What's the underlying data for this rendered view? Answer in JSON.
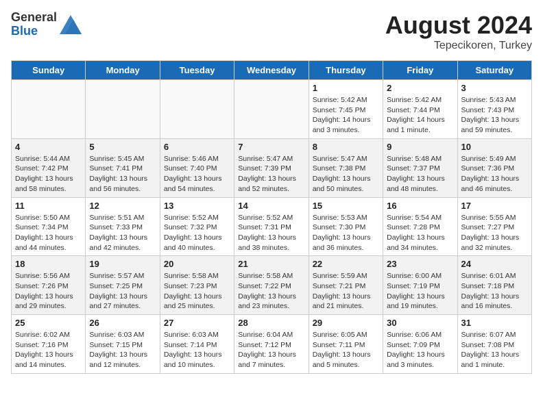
{
  "header": {
    "logo_general": "General",
    "logo_blue": "Blue",
    "month_year": "August 2024",
    "location": "Tepecikoren, Turkey"
  },
  "days_of_week": [
    "Sunday",
    "Monday",
    "Tuesday",
    "Wednesday",
    "Thursday",
    "Friday",
    "Saturday"
  ],
  "weeks": [
    [
      {
        "day": null
      },
      {
        "day": null
      },
      {
        "day": null
      },
      {
        "day": null
      },
      {
        "day": 1,
        "sunrise": "Sunrise: 5:42 AM",
        "sunset": "Sunset: 7:45 PM",
        "daylight": "Daylight: 14 hours and 3 minutes."
      },
      {
        "day": 2,
        "sunrise": "Sunrise: 5:42 AM",
        "sunset": "Sunset: 7:44 PM",
        "daylight": "Daylight: 14 hours and 1 minute."
      },
      {
        "day": 3,
        "sunrise": "Sunrise: 5:43 AM",
        "sunset": "Sunset: 7:43 PM",
        "daylight": "Daylight: 13 hours and 59 minutes."
      }
    ],
    [
      {
        "day": 4,
        "sunrise": "Sunrise: 5:44 AM",
        "sunset": "Sunset: 7:42 PM",
        "daylight": "Daylight: 13 hours and 58 minutes."
      },
      {
        "day": 5,
        "sunrise": "Sunrise: 5:45 AM",
        "sunset": "Sunset: 7:41 PM",
        "daylight": "Daylight: 13 hours and 56 minutes."
      },
      {
        "day": 6,
        "sunrise": "Sunrise: 5:46 AM",
        "sunset": "Sunset: 7:40 PM",
        "daylight": "Daylight: 13 hours and 54 minutes."
      },
      {
        "day": 7,
        "sunrise": "Sunrise: 5:47 AM",
        "sunset": "Sunset: 7:39 PM",
        "daylight": "Daylight: 13 hours and 52 minutes."
      },
      {
        "day": 8,
        "sunrise": "Sunrise: 5:47 AM",
        "sunset": "Sunset: 7:38 PM",
        "daylight": "Daylight: 13 hours and 50 minutes."
      },
      {
        "day": 9,
        "sunrise": "Sunrise: 5:48 AM",
        "sunset": "Sunset: 7:37 PM",
        "daylight": "Daylight: 13 hours and 48 minutes."
      },
      {
        "day": 10,
        "sunrise": "Sunrise: 5:49 AM",
        "sunset": "Sunset: 7:36 PM",
        "daylight": "Daylight: 13 hours and 46 minutes."
      }
    ],
    [
      {
        "day": 11,
        "sunrise": "Sunrise: 5:50 AM",
        "sunset": "Sunset: 7:34 PM",
        "daylight": "Daylight: 13 hours and 44 minutes."
      },
      {
        "day": 12,
        "sunrise": "Sunrise: 5:51 AM",
        "sunset": "Sunset: 7:33 PM",
        "daylight": "Daylight: 13 hours and 42 minutes."
      },
      {
        "day": 13,
        "sunrise": "Sunrise: 5:52 AM",
        "sunset": "Sunset: 7:32 PM",
        "daylight": "Daylight: 13 hours and 40 minutes."
      },
      {
        "day": 14,
        "sunrise": "Sunrise: 5:52 AM",
        "sunset": "Sunset: 7:31 PM",
        "daylight": "Daylight: 13 hours and 38 minutes."
      },
      {
        "day": 15,
        "sunrise": "Sunrise: 5:53 AM",
        "sunset": "Sunset: 7:30 PM",
        "daylight": "Daylight: 13 hours and 36 minutes."
      },
      {
        "day": 16,
        "sunrise": "Sunrise: 5:54 AM",
        "sunset": "Sunset: 7:28 PM",
        "daylight": "Daylight: 13 hours and 34 minutes."
      },
      {
        "day": 17,
        "sunrise": "Sunrise: 5:55 AM",
        "sunset": "Sunset: 7:27 PM",
        "daylight": "Daylight: 13 hours and 32 minutes."
      }
    ],
    [
      {
        "day": 18,
        "sunrise": "Sunrise: 5:56 AM",
        "sunset": "Sunset: 7:26 PM",
        "daylight": "Daylight: 13 hours and 29 minutes."
      },
      {
        "day": 19,
        "sunrise": "Sunrise: 5:57 AM",
        "sunset": "Sunset: 7:25 PM",
        "daylight": "Daylight: 13 hours and 27 minutes."
      },
      {
        "day": 20,
        "sunrise": "Sunrise: 5:58 AM",
        "sunset": "Sunset: 7:23 PM",
        "daylight": "Daylight: 13 hours and 25 minutes."
      },
      {
        "day": 21,
        "sunrise": "Sunrise: 5:58 AM",
        "sunset": "Sunset: 7:22 PM",
        "daylight": "Daylight: 13 hours and 23 minutes."
      },
      {
        "day": 22,
        "sunrise": "Sunrise: 5:59 AM",
        "sunset": "Sunset: 7:21 PM",
        "daylight": "Daylight: 13 hours and 21 minutes."
      },
      {
        "day": 23,
        "sunrise": "Sunrise: 6:00 AM",
        "sunset": "Sunset: 7:19 PM",
        "daylight": "Daylight: 13 hours and 19 minutes."
      },
      {
        "day": 24,
        "sunrise": "Sunrise: 6:01 AM",
        "sunset": "Sunset: 7:18 PM",
        "daylight": "Daylight: 13 hours and 16 minutes."
      }
    ],
    [
      {
        "day": 25,
        "sunrise": "Sunrise: 6:02 AM",
        "sunset": "Sunset: 7:16 PM",
        "daylight": "Daylight: 13 hours and 14 minutes."
      },
      {
        "day": 26,
        "sunrise": "Sunrise: 6:03 AM",
        "sunset": "Sunset: 7:15 PM",
        "daylight": "Daylight: 13 hours and 12 minutes."
      },
      {
        "day": 27,
        "sunrise": "Sunrise: 6:03 AM",
        "sunset": "Sunset: 7:14 PM",
        "daylight": "Daylight: 13 hours and 10 minutes."
      },
      {
        "day": 28,
        "sunrise": "Sunrise: 6:04 AM",
        "sunset": "Sunset: 7:12 PM",
        "daylight": "Daylight: 13 hours and 7 minutes."
      },
      {
        "day": 29,
        "sunrise": "Sunrise: 6:05 AM",
        "sunset": "Sunset: 7:11 PM",
        "daylight": "Daylight: 13 hours and 5 minutes."
      },
      {
        "day": 30,
        "sunrise": "Sunrise: 6:06 AM",
        "sunset": "Sunset: 7:09 PM",
        "daylight": "Daylight: 13 hours and 3 minutes."
      },
      {
        "day": 31,
        "sunrise": "Sunrise: 6:07 AM",
        "sunset": "Sunset: 7:08 PM",
        "daylight": "Daylight: 13 hours and 1 minute."
      }
    ]
  ]
}
